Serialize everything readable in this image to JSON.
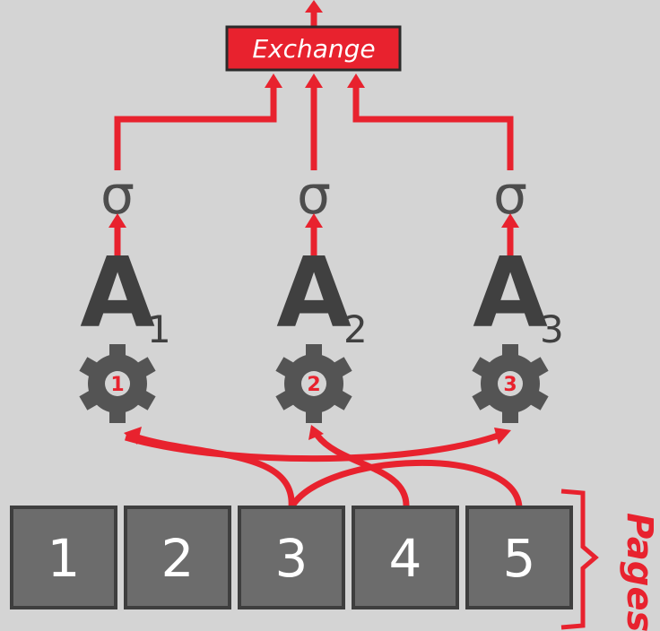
{
  "exchange": {
    "label": "Exchange"
  },
  "workers": [
    {
      "filter_symbol": "σ",
      "access_letter": "A",
      "subscript": "1",
      "gear_number": "1"
    },
    {
      "filter_symbol": "σ",
      "access_letter": "A",
      "subscript": "2",
      "gear_number": "2"
    },
    {
      "filter_symbol": "σ",
      "access_letter": "A",
      "subscript": "3",
      "gear_number": "3"
    }
  ],
  "pages": [
    "1",
    "2",
    "3",
    "4",
    "5"
  ],
  "pages_label": "Pages",
  "colors": {
    "accent": "#e8222e",
    "background": "#d4d4d4",
    "page_fill": "#6c6c6c",
    "glyph": "#404040"
  }
}
